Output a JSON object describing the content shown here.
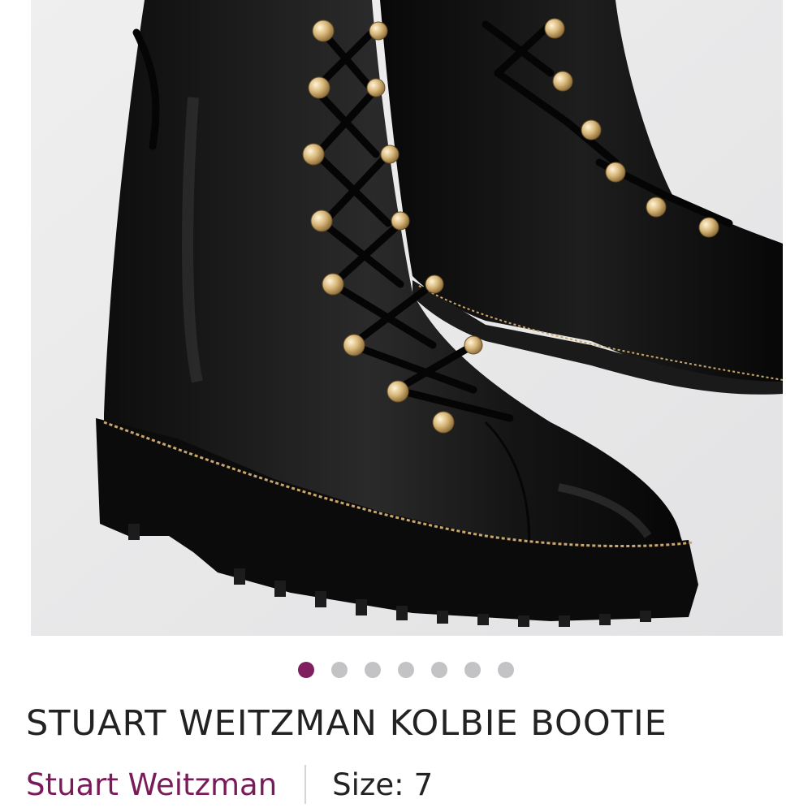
{
  "product": {
    "title": "STUART WEITZMAN KOLBIE BOOTIE",
    "brand": "Stuart Weitzman",
    "size_label": "Size:",
    "size_value": "7"
  },
  "carousel": {
    "total_images": 7,
    "active_index": 0
  },
  "colors": {
    "accent": "#7f1f5f",
    "brand_text": "#7a1b59",
    "dot_inactive": "#c3c3c6",
    "title_text": "#222222"
  }
}
